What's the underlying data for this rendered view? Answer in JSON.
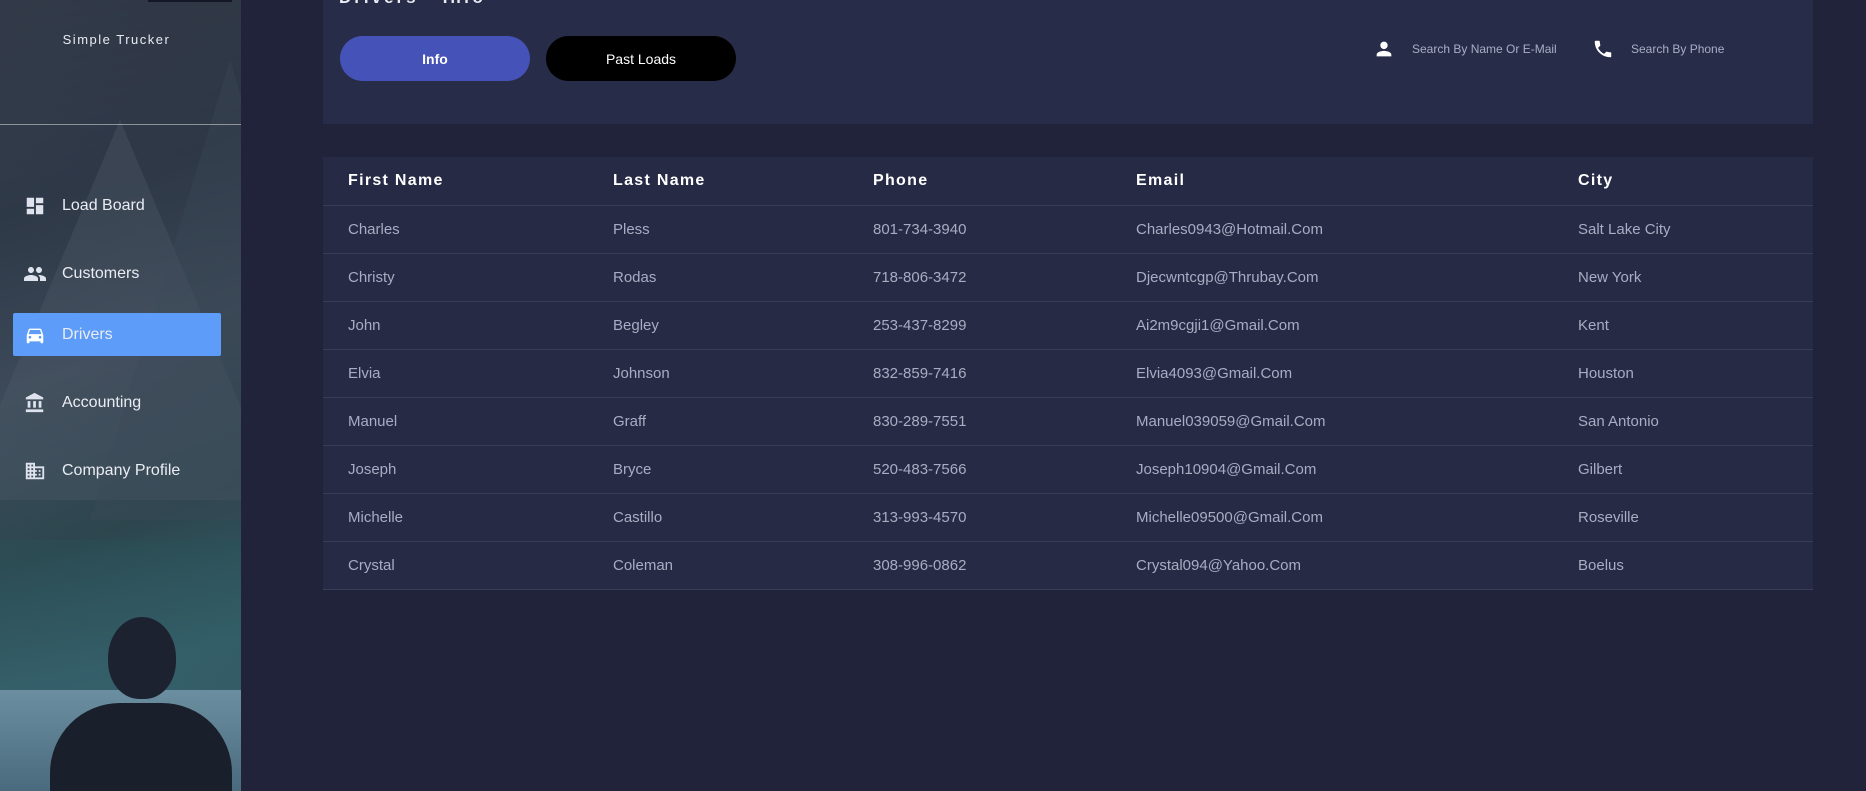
{
  "sidebar": {
    "brand": "Simple Trucker",
    "items": [
      {
        "label": "Load Board",
        "icon": "dashboard-icon"
      },
      {
        "label": "Customers",
        "icon": "people-icon"
      },
      {
        "label": "Drivers",
        "icon": "car-icon",
        "active": true
      },
      {
        "label": "Accounting",
        "icon": "bank-icon"
      },
      {
        "label": "Company Profile",
        "icon": "building-icon"
      }
    ],
    "active_color": "#5d9cf8"
  },
  "header": {
    "title": "Drivers - Info",
    "tabs": [
      {
        "label": "Info",
        "active": true
      },
      {
        "label": "Past Loads",
        "active": false
      }
    ],
    "search_name": {
      "placeholder": "Search By Name Or E-Mail",
      "icon": "person-icon"
    },
    "search_phone": {
      "placeholder": "Search By Phone",
      "icon": "phone-icon"
    }
  },
  "table": {
    "columns": [
      "First Name",
      "Last Name",
      "Phone",
      "Email",
      "City"
    ],
    "rows": [
      [
        "Charles",
        "Pless",
        "801-734-3940",
        "Charles0943@Hotmail.Com",
        "Salt Lake City"
      ],
      [
        "Christy",
        "Rodas",
        "718-806-3472",
        "Djecwntcgp@Thrubay.Com",
        "New York"
      ],
      [
        "John",
        "Begley",
        "253-437-8299",
        "Ai2m9cgji1@Gmail.Com",
        "Kent"
      ],
      [
        "Elvia",
        "Johnson",
        "832-859-7416",
        "Elvia4093@Gmail.Com",
        "Houston"
      ],
      [
        "Manuel",
        "Graff",
        "830-289-7551",
        "Manuel039059@Gmail.Com",
        "San Antonio"
      ],
      [
        "Joseph",
        "Bryce",
        "520-483-7566",
        "Joseph10904@Gmail.Com",
        "Gilbert"
      ],
      [
        "Michelle",
        "Castillo",
        "313-993-4570",
        "Michelle09500@Gmail.Com",
        "Roseville"
      ],
      [
        "Crystal",
        "Coleman",
        "308-996-0862",
        "Crystal094@Yahoo.Com",
        "Boelus"
      ]
    ]
  },
  "colors": {
    "background": "#202339",
    "panel": "#272c48",
    "info_button": "#4552b8",
    "past_loads_button": "#000000"
  }
}
